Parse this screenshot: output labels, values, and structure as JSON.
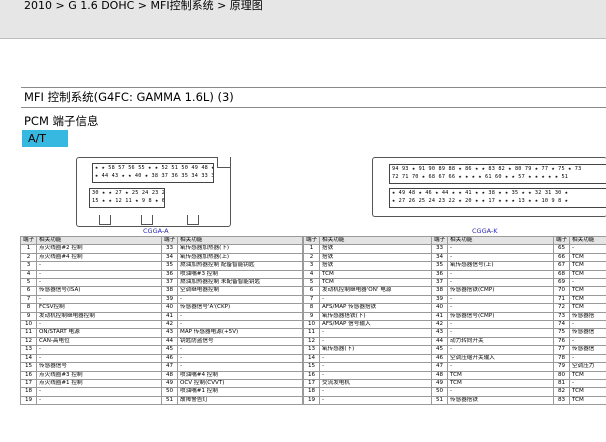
{
  "breadcrumb": "2010 > G 1.6 DOHC > MFI控制系统 > 原理图",
  "page_title": "MFI 控制系统(G4FC: GAMMA 1.6L) (3)",
  "section_title": "PCM 端子信息",
  "tab_label": "A/T",
  "connector_a": {
    "label": "CGGA-A",
    "top_rows": [
      "★ ★ 58 57 56 55 ★ ★ 52 51 50 49 48 ★ ★ ★",
      "★ 44 43 ★ ★ 40 ★ 38 37 36 35 34 33 32 ★"
    ],
    "bottom_rows": [
      "30 ★ ★ 27 ★ 25 24 23 22 21 ★ ★ ★ 17 16",
      "15 ★ ★ 12 11 ★ 9 8 ★ 6 ★ ★ ★ 2 1"
    ]
  },
  "connector_k": {
    "label": "CGGA-K",
    "top_rows": [
      "94 93 ★ 91 90 89 88 ★ 86 ★ ★ 83 82 ★ 80 79 ★ 77 ★ 75 ★ 73",
      "72 71 70 ★ 68 67 66 ★ ★ ★ ★ 61 60 ★ ★ 57 ★ ★ ★ ★ ★ 51"
    ],
    "bottom_rows": [
      "★ 49 48 ★ 46 ★ 44 ★ ★ 41 ★ ★ 38 ★ ★ 35 ★ ★ 32 31 30 ★",
      "★ 27 26 25 24 23 22 ★ 20 ★ ★ 17 ★ ★ ★ 13 ★ ★ 10 9 8 ★"
    ]
  },
  "table_a": {
    "headers": [
      "端子",
      "相关功能",
      "端子",
      "相关功能"
    ],
    "rows": [
      [
        "1",
        "点火线圈#2 控制",
        "33",
        "氧传感器加热器(下)"
      ],
      [
        "2",
        "点火线圈#4 控制",
        "34",
        "氧传感器加热器(上)"
      ],
      [
        "3",
        "-",
        "35",
        "燃油加热器控制 配备智能钥匙"
      ],
      [
        "4",
        "-",
        "36",
        "喷油嘴#3 控制"
      ],
      [
        "5",
        "-",
        "37",
        "燃油加热器控制 未配备智能钥匙"
      ],
      [
        "6",
        "传感器信号(ISA)",
        "38",
        "空调继电器控制"
      ],
      [
        "7",
        "-",
        "39",
        "-"
      ],
      [
        "8",
        "FCSV控制",
        "40",
        "传感器信号'A'(CKP)"
      ],
      [
        "9",
        "发动机控制继电器控制",
        "41",
        "-"
      ],
      [
        "10",
        "-",
        "42",
        "-"
      ],
      [
        "11",
        "ON/START 电源",
        "43",
        "MAP 传感器电源(+5V)"
      ],
      [
        "12",
        "CAN-高电位",
        "44",
        "钥匙防盗信号"
      ],
      [
        "13",
        "-",
        "45",
        "-"
      ],
      [
        "14",
        "-",
        "46",
        "-"
      ],
      [
        "15",
        "传感器信号",
        "47",
        "-"
      ],
      [
        "16",
        "点火线圈#3 控制",
        "48",
        "喷油嘴#4 控制"
      ],
      [
        "17",
        "点火线圈#1 控制",
        "49",
        "OCV 控制(CVVT)"
      ],
      [
        "18",
        "-",
        "50",
        "喷油嘴#1 控制"
      ],
      [
        "19",
        "-",
        "51",
        "故障警告灯"
      ]
    ]
  },
  "table_k": {
    "headers": [
      "端子",
      "相关功能",
      "端子",
      "相关功能",
      "端子",
      "相关功能"
    ],
    "rows": [
      [
        "1",
        "搭铁",
        "33",
        "-",
        "65",
        "-"
      ],
      [
        "2",
        "搭铁",
        "34",
        "-",
        "66",
        "TCM"
      ],
      [
        "3",
        "搭铁",
        "35",
        "氧传感器信号(上)",
        "67",
        "TCM"
      ],
      [
        "4",
        "TCM",
        "36",
        "-",
        "68",
        "TCM"
      ],
      [
        "5",
        "TCM",
        "37",
        "-",
        "69",
        "-"
      ],
      [
        "6",
        "发动机控制继电器'ON' 电源",
        "38",
        "传感器搭铁(CMP)",
        "70",
        "TCM"
      ],
      [
        "7",
        "-",
        "39",
        "-",
        "71",
        "TCM"
      ],
      [
        "8",
        "AFS/MAP 传感器搭铁",
        "40",
        "-",
        "72",
        "TCM"
      ],
      [
        "9",
        "氧传感器搭铁(下)",
        "41",
        "传感器信号(CMP)",
        "73",
        "传感器搭"
      ],
      [
        "10",
        "AFS/MAP 信号输入",
        "42",
        "-",
        "74",
        "-"
      ],
      [
        "11",
        "-",
        "43",
        "-",
        "75",
        "传感器信"
      ],
      [
        "12",
        "-",
        "44",
        "动力转向开关",
        "76",
        "-"
      ],
      [
        "13",
        "氧传感器(下)",
        "45",
        "-",
        "77",
        "传感器信"
      ],
      [
        "14",
        "-",
        "46",
        "空调压缩开关输入",
        "78",
        "-"
      ],
      [
        "15",
        "-",
        "47",
        "-",
        "79",
        "空调压力"
      ],
      [
        "16",
        "-",
        "48",
        "TCM",
        "80",
        "TCM"
      ],
      [
        "17",
        "交流发电机",
        "49",
        "TCM",
        "81",
        "-"
      ],
      [
        "18",
        "-",
        "50",
        "-",
        "82",
        "TCM"
      ],
      [
        "19",
        "-",
        "51",
        "传感器搭铁",
        "83",
        "TCM"
      ]
    ]
  }
}
